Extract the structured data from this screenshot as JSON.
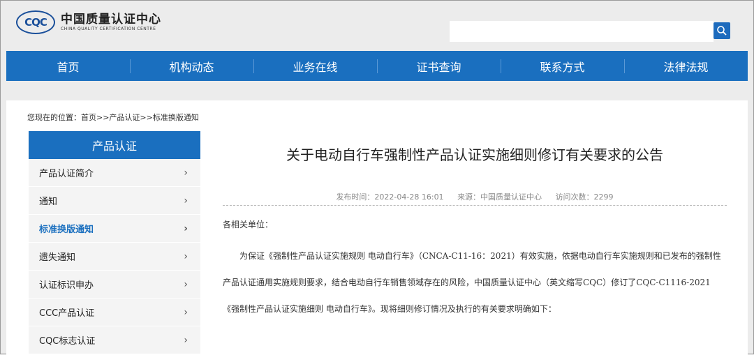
{
  "header": {
    "logo_mark": "CQC",
    "logo_cn": "中国质量认证中心",
    "logo_en": "CHINA QUALITY CERTIFICATION CENTRE",
    "search_placeholder": "",
    "search_icon": "magnifier-icon"
  },
  "nav": {
    "items": [
      "首页",
      "机构动态",
      "业务在线",
      "证书查询",
      "联系方式",
      "法律法规"
    ]
  },
  "breadcrumb": "您现在的位置：首页>>产品认证>>标准换版通知",
  "sidebar": {
    "title": "产品认证",
    "items": [
      "产品认证简介",
      "通知",
      "标准换版通知",
      "遗失通知",
      "认证标识申办",
      "CCC产品认证",
      "CQC标志认证"
    ],
    "active_index": 2,
    "chevron": "›"
  },
  "article": {
    "title": "关于电动自行车强制性产品认证实施细则修订有关要求的公告",
    "publish": "发布时间：2022-04-28 16:01",
    "source": "来源：中国质量认证中心",
    "visits": "访问次数：2299",
    "salutation": "各相关单位：",
    "body": "为保证《强制性产品认证实施规则 电动自行车》（CNCA-C11-16：2021）有效实施，依据电动自行车实施规则和已发布的强制性产品认证通用实施规则要求，结合电动自行车销售领域存在的风险，中国质量认证中心（英文缩写CQC）修订了CQC-C1116-2021《强制性产品认证实施细则 电动自行车》。现将细则修订情况及执行的有关要求明确如下："
  },
  "colors": {
    "primary": "#1a6fbf",
    "background": "#ececec"
  }
}
